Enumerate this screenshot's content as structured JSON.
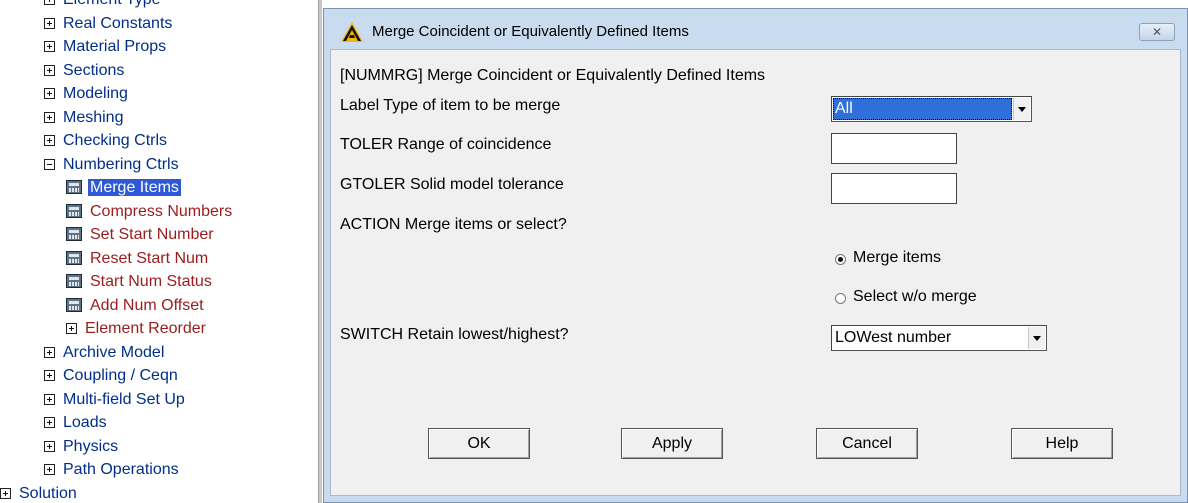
{
  "tree": {
    "items": [
      {
        "label": "Element Type",
        "kind": "plus"
      },
      {
        "label": "Real Constants",
        "kind": "plus"
      },
      {
        "label": "Material Props",
        "kind": "plus"
      },
      {
        "label": "Sections",
        "kind": "plus"
      },
      {
        "label": "Modeling",
        "kind": "plus"
      },
      {
        "label": "Meshing",
        "kind": "plus"
      },
      {
        "label": "Checking Ctrls",
        "kind": "plus"
      },
      {
        "label": "Numbering Ctrls",
        "kind": "minus"
      },
      {
        "label": "Merge Items",
        "kind": "cmd",
        "selected": true
      },
      {
        "label": "Compress Numbers",
        "kind": "cmd"
      },
      {
        "label": "Set Start Number",
        "kind": "cmd"
      },
      {
        "label": "Reset Start Num",
        "kind": "cmd"
      },
      {
        "label": "Start Num Status",
        "kind": "cmd"
      },
      {
        "label": "Add Num Offset",
        "kind": "cmd"
      },
      {
        "label": "Element Reorder",
        "kind": "plus"
      },
      {
        "label": "Archive Model",
        "kind": "plus"
      },
      {
        "label": "Coupling / Ceqn",
        "kind": "plus"
      },
      {
        "label": "Multi-field Set Up",
        "kind": "plus"
      },
      {
        "label": "Loads",
        "kind": "plus"
      },
      {
        "label": "Physics",
        "kind": "plus"
      },
      {
        "label": "Path Operations",
        "kind": "plus"
      },
      {
        "label": "Solution",
        "kind": "plus"
      }
    ]
  },
  "dialog": {
    "title": "Merge Coincident or Equivalently Defined Items",
    "close_glyph": "✕",
    "heading": "[NUMMRG]  Merge Coincident or Equivalently Defined Items",
    "label_field": {
      "text": "Label   Type of item to be merge",
      "value": "All"
    },
    "toler_field": {
      "text": "TOLER   Range of coincidence",
      "value": ""
    },
    "gtoler_field": {
      "text": "GTOLER  Solid model tolerance",
      "value": ""
    },
    "action_label": "ACTION  Merge items or select?",
    "radio_merge": "Merge items",
    "radio_select": "Select w/o merge",
    "switch_field": {
      "text": "SWITCH  Retain lowest/highest?",
      "value": "LOWest number"
    },
    "buttons": {
      "ok": "OK",
      "apply": "Apply",
      "cancel": "Cancel",
      "help": "Help"
    }
  },
  "colors": {
    "tree_text": "#002e8a",
    "tree_command_text": "#9b1c1c",
    "selection": "#2e58d6",
    "dialog_frame": "#c9dbef",
    "logo_yellow": "#f2b705"
  }
}
